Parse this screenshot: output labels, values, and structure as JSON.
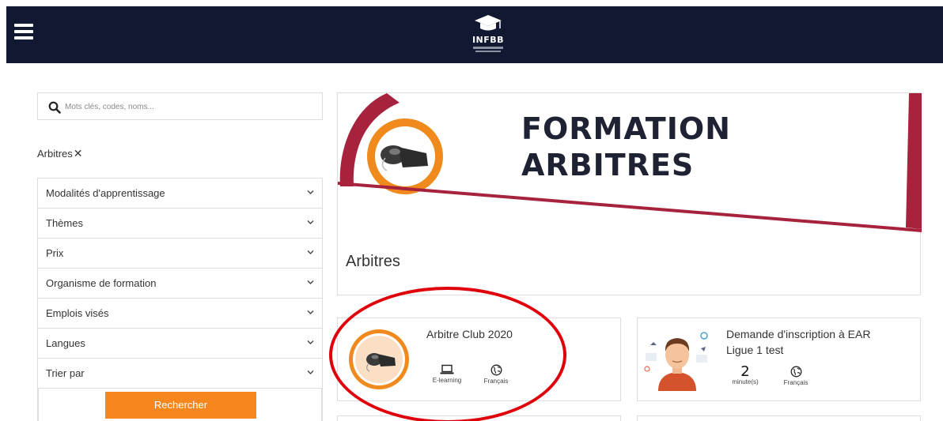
{
  "header": {
    "menu_icon": "hamburger-icon",
    "logo_text": "INFBB",
    "logo_icon": "graduation-cap-icon"
  },
  "search": {
    "placeholder": "Mots clés, codes, noms...",
    "icon": "search-icon"
  },
  "active_tag": {
    "label": "Arbitres",
    "remove_icon": "close-icon",
    "remove_glyph": "✕"
  },
  "filters": [
    {
      "label": "Modalités d'apprentissage"
    },
    {
      "label": "Thèmes"
    },
    {
      "label": "Prix"
    },
    {
      "label": "Organisme de formation"
    },
    {
      "label": "Emplois visés"
    },
    {
      "label": "Langues"
    },
    {
      "label": "Trier par"
    }
  ],
  "search_button": {
    "label": "Rechercher"
  },
  "banner": {
    "title_line1": "FORMATION",
    "title_line2": "ARBITRES",
    "subtitle": "Arbitres",
    "colors": {
      "accent_red": "#a6223d",
      "accent_orange": "#f08a1d",
      "dark": "#1e2233"
    }
  },
  "courses": [
    {
      "title": "Arbitre Club 2020",
      "meta": [
        {
          "icon": "laptop-icon",
          "label": "E-learning"
        },
        {
          "icon": "globe-icon",
          "label": "Français"
        }
      ]
    },
    {
      "title_line1": "Demande d'inscription à EAR",
      "title_line2": "Ligue 1 test",
      "meta": [
        {
          "value": "2",
          "label": "minute(s)"
        },
        {
          "icon": "globe-icon",
          "label": "Français"
        }
      ]
    }
  ],
  "colors": {
    "header_bg": "#111832",
    "button_bg": "#f7861d",
    "highlight_circle": "#e0000b"
  }
}
